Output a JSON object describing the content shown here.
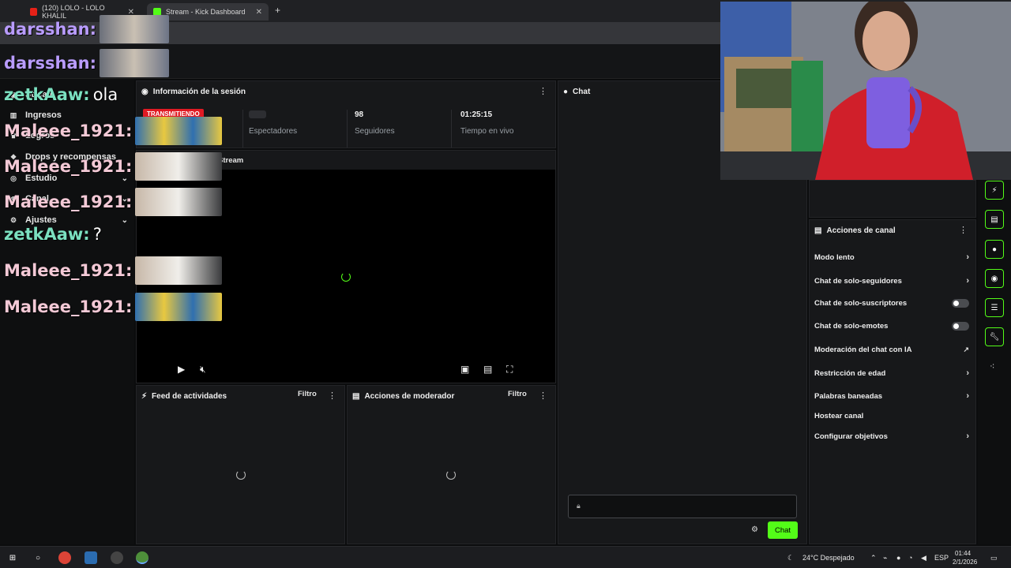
{
  "browser": {
    "tabs": [
      {
        "label": "(120) LOLO - LOLO KHALIL",
        "favicon_color": "#e62117"
      },
      {
        "label": "Stream - Kick Dashboard",
        "favicon_color": "#53fc18"
      }
    ],
    "url_fragment": "ream"
  },
  "sidebar": {
    "items": [
      {
        "label": "Stream",
        "icon": "broadcast-icon"
      },
      {
        "label": "Ingresos",
        "icon": "grid-icon"
      },
      {
        "label": "Logros",
        "icon": "trophy-icon"
      },
      {
        "label": "Drops y recompensas",
        "icon": "gift-icon"
      },
      {
        "label": "Estudio",
        "icon": "camera-icon",
        "chevron": "⌄"
      },
      {
        "label": "Canal",
        "icon": "user-icon",
        "chevron": "⌄"
      },
      {
        "label": "Ajustes",
        "icon": "gear-icon",
        "chevron": "⌄"
      }
    ]
  },
  "session": {
    "title": "Información de la sesión",
    "live_badge": "TRANSMITIENDO",
    "stats": [
      {
        "value": "",
        "label": "Espectadores"
      },
      {
        "value": "98",
        "label": "Seguidores"
      },
      {
        "value": "01:25:15",
        "label": "Tiempo en vivo"
      }
    ]
  },
  "preview": {
    "title": "Stream"
  },
  "activity_feed": {
    "title": "Feed de actividades",
    "filter": "Filtro"
  },
  "mod_actions": {
    "title": "Acciones de moderador",
    "filter": "Filtro"
  },
  "chat": {
    "title": "Chat",
    "send_label": "Chat"
  },
  "channel_actions": {
    "title": "Acciones de canal",
    "items": [
      {
        "label": "Modo lento",
        "control": "chevron"
      },
      {
        "label": "Chat de solo-seguidores",
        "control": "chevron"
      },
      {
        "label": "Chat de solo-suscriptores",
        "control": "toggle",
        "on": false
      },
      {
        "label": "Chat de solo-emotes",
        "control": "toggle",
        "on": false
      },
      {
        "label": "Moderación del chat con IA",
        "control": "external"
      },
      {
        "label": "Restricción de edad",
        "control": "chevron"
      },
      {
        "label": "Palabras baneadas",
        "control": "chevron"
      },
      {
        "label": "Hostear canal",
        "control": "none"
      },
      {
        "label": "Configurar objetivos",
        "control": "chevron"
      }
    ]
  },
  "overlay_chat": [
    {
      "user": "darsshan:",
      "color": "#b99cff",
      "text": "",
      "emote": true
    },
    {
      "user": "darsshan:",
      "color": "#b99cff",
      "text": "",
      "emote": true
    },
    {
      "user": "zetkAaw:",
      "color": "#7be0c0",
      "text": "ola",
      "emote": false
    },
    {
      "user": "Maleee_1921:",
      "color": "#f3c9d6",
      "text": "",
      "emote": true
    },
    {
      "user": "Maleee_1921:",
      "color": "#f3c9d6",
      "text": "",
      "emote": true
    },
    {
      "user": "Maleee_1921:",
      "color": "#f3c9d6",
      "text": "",
      "emote": true
    },
    {
      "user": "zetkAaw:",
      "color": "#7be0c0",
      "text": "?",
      "emote": false
    },
    {
      "user": "Maleee_1921:",
      "color": "#f3c9d6",
      "text": "",
      "emote": true
    },
    {
      "user": "Maleee_1921:",
      "color": "#f3c9d6",
      "text": "",
      "emote": true
    }
  ],
  "taskbar": {
    "weather": "24°C  Despejado",
    "lang": "ESP",
    "time": "01:44",
    "date": "2/1/2026"
  }
}
